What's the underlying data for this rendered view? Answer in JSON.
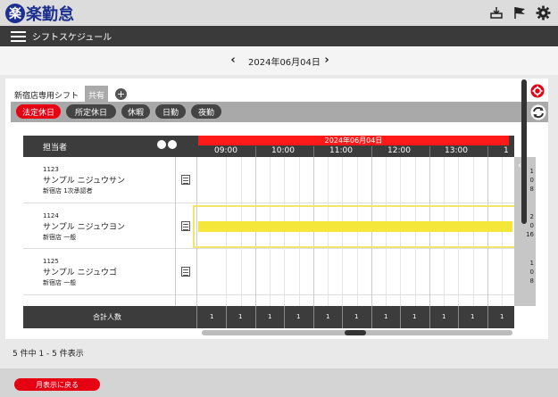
{
  "app": {
    "logo_mark": "楽",
    "logo_text": "楽勤怠"
  },
  "icons": {
    "inbox": "inbox-icon",
    "flag": "flag-icon",
    "gear": "gear-icon"
  },
  "header": {
    "title": "シフトスケジュール"
  },
  "date_nav": {
    "prev": "‹",
    "current": "2024年06月04日",
    "next": "›"
  },
  "tabs": [
    {
      "label": "新宿店専用シフト"
    },
    {
      "label": "共有"
    }
  ],
  "tab_add": "+",
  "filters": [
    {
      "label": "法定休日"
    },
    {
      "label": "所定休日"
    },
    {
      "label": "休暇"
    },
    {
      "label": "日勤"
    },
    {
      "label": "夜勤"
    }
  ],
  "grid": {
    "staff_header": "担当者",
    "date_band": "2024年06月04日",
    "hours": [
      "09:00",
      "10:00",
      "11:00",
      "12:00",
      "13:00",
      "1"
    ],
    "collapse": "‹",
    "rows": [
      {
        "code": "1123",
        "name": "サンプル ニジュウサン",
        "store": "新宿店 1次承認者",
        "nums": [
          "1",
          "0",
          "8"
        ]
      },
      {
        "code": "1124",
        "name": "サンプル ニジュウヨン",
        "store": "新宿店 一般",
        "nums": [
          "2",
          "0",
          "16"
        ]
      },
      {
        "code": "1125",
        "name": "サンプル ニジュウゴ",
        "store": "新宿店 一般",
        "nums": [
          "1",
          "0",
          "8"
        ]
      }
    ],
    "footer_label": "合計人数",
    "footer_counts": [
      "1",
      "1",
      "1",
      "1",
      "1",
      "1",
      "1",
      "1",
      "1",
      "1",
      "1"
    ]
  },
  "record_count": "5 件中 1 - 5 件表示",
  "back_button": "月表示に戻る",
  "colors": {
    "brand": "#1c2e8f",
    "accent_red": "#e60012",
    "shift_yellow": "#f5e63a"
  }
}
